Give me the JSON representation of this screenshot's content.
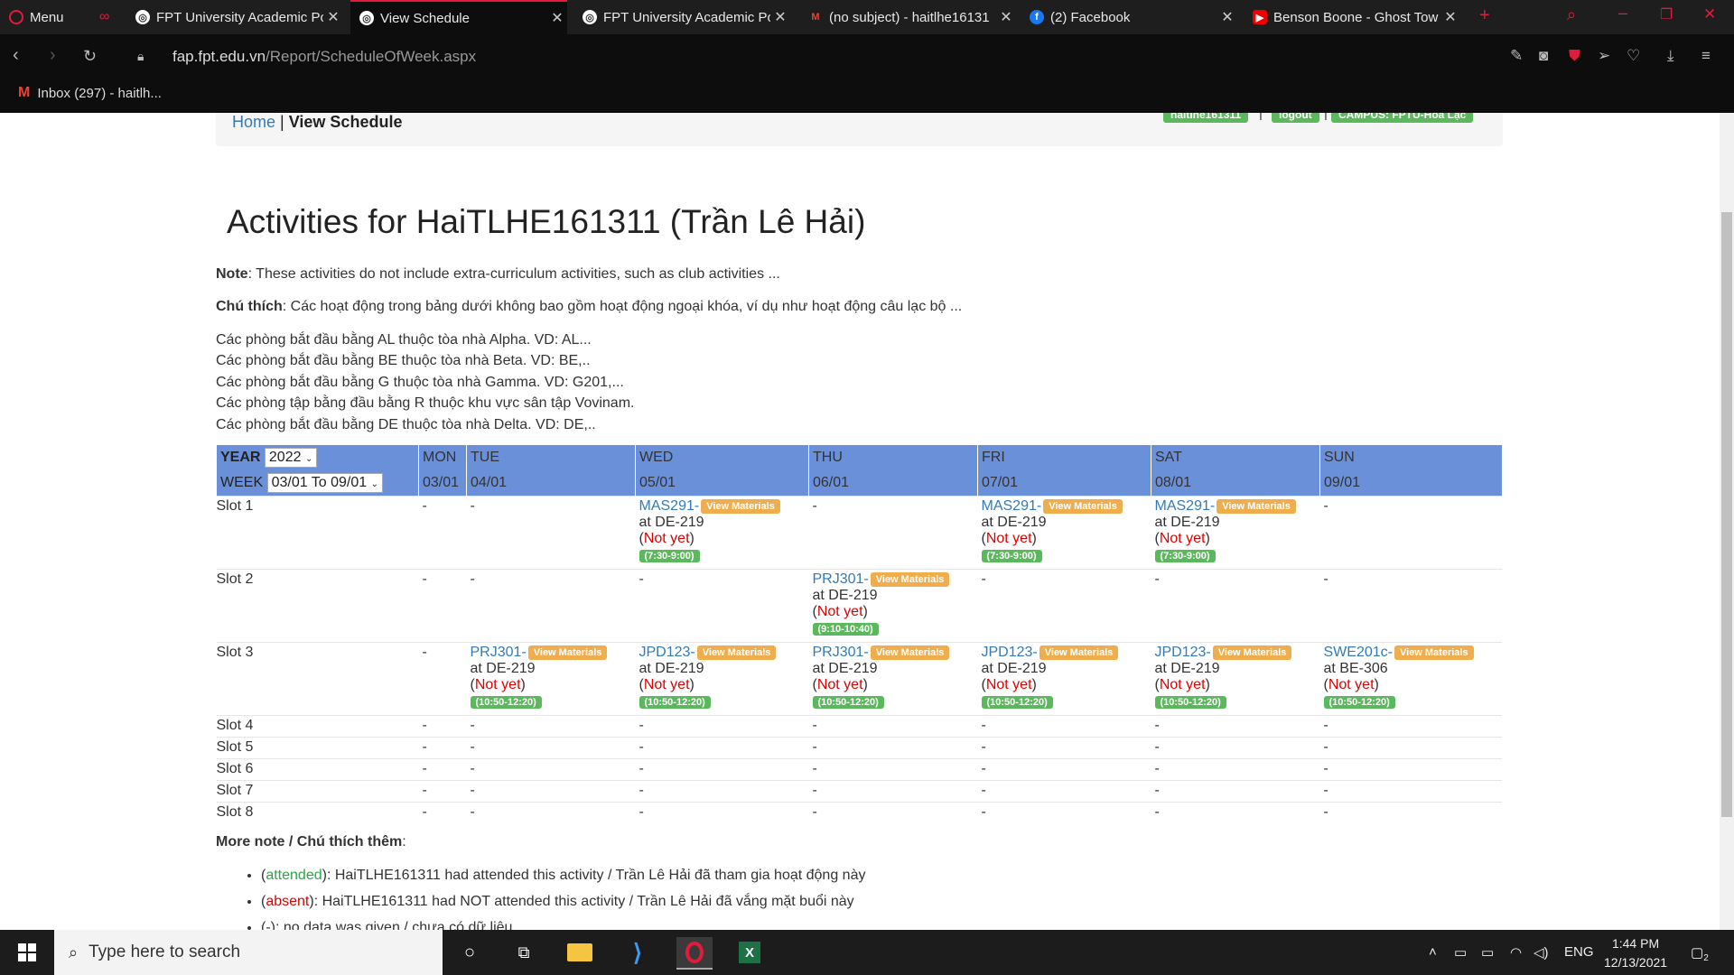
{
  "browser": {
    "menu_label": "Menu",
    "tabs": [
      {
        "title": "FPT University Academic Po",
        "icon": "globe-icon"
      },
      {
        "title": "View Schedule",
        "icon": "globe-icon",
        "active": true
      },
      {
        "title": "FPT University Academic Po",
        "icon": "globe-icon"
      },
      {
        "title": "(no subject) - haitlhe16131",
        "icon": "gmail-icon"
      },
      {
        "title": "(2) Facebook",
        "icon": "facebook-icon"
      },
      {
        "title": "Benson Boone - Ghost Tow",
        "icon": "youtube-icon"
      }
    ],
    "url_host": "fap.fpt.edu.vn",
    "url_path": "/Report/ScheduleOfWeek.aspx",
    "bookmark": "Inbox (297) - haitlh..."
  },
  "page": {
    "breadcrumb_home": "Home",
    "breadcrumb_sep": "|",
    "breadcrumb_current": "View Schedule",
    "user_label": "haitlhe161311",
    "logout_label": "logout",
    "campus_label": "CAMPUS: FPTU-Hòa Lạc",
    "title": "Activities for HaiTLHE161311 (Trần Lê Hải)",
    "note_label": "Note",
    "note_text": ": These activities do not include extra-curriculum activities, such as club activities ...",
    "chuthich_label": "Chú thích",
    "chuthich_text": ": Các hoạt động trong bảng dưới không bao gồm hoạt động ngoại khóa, ví dụ như hoạt động câu lạc bộ ...",
    "rooms": [
      "Các phòng bắt đầu bằng AL thuộc tòa nhà Alpha. VD: AL...",
      "Các phòng bắt đầu bằng BE thuộc tòa nhà Beta. VD: BE,..",
      "Các phòng bắt đầu bằng G thuộc tòa nhà Gamma. VD: G201,...",
      "Các phòng tập bằng đầu bằng R thuộc khu vực sân tập Vovinam.",
      "Các phòng bắt đầu bằng DE thuộc tòa nhà Delta. VD: DE,.."
    ]
  },
  "schedule": {
    "year_label": "YEAR",
    "year_value": "2022",
    "week_label": "WEEK",
    "week_value": "03/01 To 09/01",
    "days": [
      "MON",
      "TUE",
      "WED",
      "THU",
      "FRI",
      "SAT",
      "SUN"
    ],
    "dates": [
      "03/01",
      "04/01",
      "05/01",
      "06/01",
      "07/01",
      "08/01",
      "09/01"
    ],
    "view_materials": "View Materials",
    "not_yet": "Not yet",
    "slots": [
      {
        "name": "Slot 1",
        "cells": [
          null,
          null,
          {
            "subject": "MAS291-",
            "room": "at DE-219",
            "time": "(7:30-9:00)"
          },
          null,
          {
            "subject": "MAS291-",
            "room": "at DE-219",
            "time": "(7:30-9:00)"
          },
          {
            "subject": "MAS291-",
            "room": "at DE-219",
            "time": "(7:30-9:00)"
          },
          null
        ]
      },
      {
        "name": "Slot 2",
        "cells": [
          null,
          null,
          null,
          {
            "subject": "PRJ301-",
            "room": "at DE-219",
            "time": "(9:10-10:40)"
          },
          null,
          null,
          null
        ]
      },
      {
        "name": "Slot 3",
        "cells": [
          null,
          {
            "subject": "PRJ301-",
            "room": "at DE-219",
            "time": "(10:50-12:20)"
          },
          {
            "subject": "JPD123-",
            "room": "at DE-219",
            "time": "(10:50-12:20)"
          },
          {
            "subject": "PRJ301-",
            "room": "at DE-219",
            "time": "(10:50-12:20)"
          },
          {
            "subject": "JPD123-",
            "room": "at DE-219",
            "time": "(10:50-12:20)"
          },
          {
            "subject": "JPD123-",
            "room": "at DE-219",
            "time": "(10:50-12:20)"
          },
          {
            "subject": "SWE201c-",
            "room": "at BE-306",
            "time": "(10:50-12:20)"
          }
        ]
      },
      {
        "name": "Slot 4",
        "cells": [
          null,
          null,
          null,
          null,
          null,
          null,
          null
        ]
      },
      {
        "name": "Slot 5",
        "cells": [
          null,
          null,
          null,
          null,
          null,
          null,
          null
        ]
      },
      {
        "name": "Slot 6",
        "cells": [
          null,
          null,
          null,
          null,
          null,
          null,
          null
        ]
      },
      {
        "name": "Slot 7",
        "cells": [
          null,
          null,
          null,
          null,
          null,
          null,
          null
        ]
      },
      {
        "name": "Slot 8",
        "cells": [
          null,
          null,
          null,
          null,
          null,
          null,
          null
        ]
      }
    ],
    "empty": "-"
  },
  "notes": {
    "heading_bold": "More note / Chú thích thêm",
    "heading_tail": ":",
    "items": [
      {
        "tag": "attended",
        "text": ": HaiTLHE161311 had attended this activity / Trần Lê Hải đã tham gia hoạt động này"
      },
      {
        "tag": "absent",
        "text": ": HaiTLHE161311 had NOT attended this activity / Trần Lê Hải đã vắng mặt buổi này"
      },
      {
        "tag": "-",
        "text": ": no data was given / chưa có dữ liệu"
      }
    ]
  },
  "taskbar": {
    "search_placeholder": "Type here to search",
    "lang": "ENG",
    "time": "1:44 PM",
    "date": "12/13/2021",
    "notif_count": "2"
  },
  "colors": {
    "header_blue": "#6b90da",
    "green": "#5cb85c",
    "orange": "#f0ad4e",
    "link": "#337ab7",
    "opera_red": "#e01b3c"
  }
}
